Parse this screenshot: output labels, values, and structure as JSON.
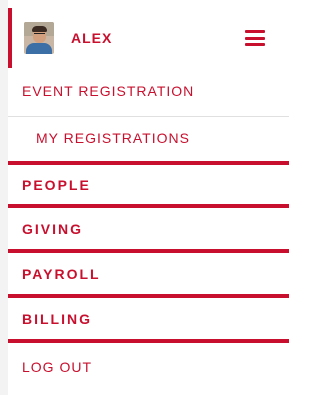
{
  "user": {
    "name": "ALEX"
  },
  "header": {
    "menu_icon": "hamburger-icon"
  },
  "menu": {
    "items": [
      {
        "label": "EVENT REGISTRATION"
      },
      {
        "label": "MY REGISTRATIONS"
      },
      {
        "label": "PEOPLE"
      },
      {
        "label": "GIVING"
      },
      {
        "label": "PAYROLL"
      },
      {
        "label": "BILLING"
      },
      {
        "label": "LOG OUT"
      }
    ]
  },
  "colors": {
    "accent": "#c8102e",
    "gutter": "#f3f3f3"
  }
}
